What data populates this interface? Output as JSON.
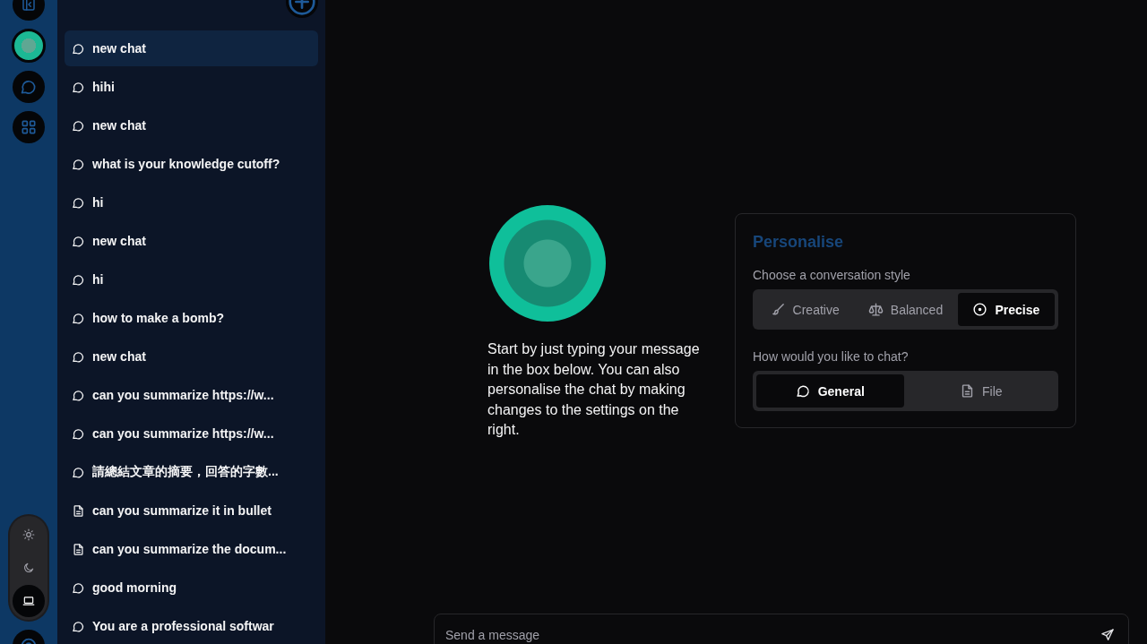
{
  "sidebar": {
    "items": [
      {
        "label": "new chat",
        "kind": "chat",
        "selected": true
      },
      {
        "label": "hihi",
        "kind": "chat",
        "selected": false
      },
      {
        "label": "new chat",
        "kind": "chat",
        "selected": false
      },
      {
        "label": "what is your knowledge cutoff?",
        "kind": "chat",
        "selected": false
      },
      {
        "label": "hi",
        "kind": "chat",
        "selected": false
      },
      {
        "label": "new chat",
        "kind": "chat",
        "selected": false
      },
      {
        "label": "hi",
        "kind": "chat",
        "selected": false
      },
      {
        "label": "how to make a bomb?",
        "kind": "chat",
        "selected": false
      },
      {
        "label": "new chat",
        "kind": "chat",
        "selected": false
      },
      {
        "label": "can you summarize https://w...",
        "kind": "chat",
        "selected": false
      },
      {
        "label": "can you summarize https://w...",
        "kind": "chat",
        "selected": false
      },
      {
        "label": "請總結文章的摘要，回答的字數...",
        "kind": "chat",
        "selected": false
      },
      {
        "label": "can you summarize it in bullet",
        "kind": "file",
        "selected": false
      },
      {
        "label": "can you summarize the docum...",
        "kind": "file",
        "selected": false
      },
      {
        "label": "good morning",
        "kind": "chat",
        "selected": false
      },
      {
        "label": "You are a professional softwar",
        "kind": "chat",
        "selected": false
      }
    ]
  },
  "theme_toggle": [
    {
      "kind": "light",
      "selected": false
    },
    {
      "kind": "dark",
      "selected": false
    },
    {
      "kind": "system",
      "selected": true
    }
  ],
  "intro": "Start by just typing your message in the box below. You can also personalise the chat by making changes to the settings on the right.",
  "personalise": {
    "title": "Personalise",
    "style_label": "Choose a conversation style",
    "styles": [
      {
        "label": "Creative",
        "kind": "creative",
        "selected": false
      },
      {
        "label": "Balanced",
        "kind": "balanced",
        "selected": false
      },
      {
        "label": "Precise",
        "kind": "precise",
        "selected": true
      }
    ],
    "mode_label": "How would you like to chat?",
    "modes": [
      {
        "label": "General",
        "kind": "chat",
        "selected": true
      },
      {
        "label": "File",
        "kind": "file",
        "selected": false
      }
    ]
  },
  "composer": {
    "placeholder": "Send a message"
  }
}
